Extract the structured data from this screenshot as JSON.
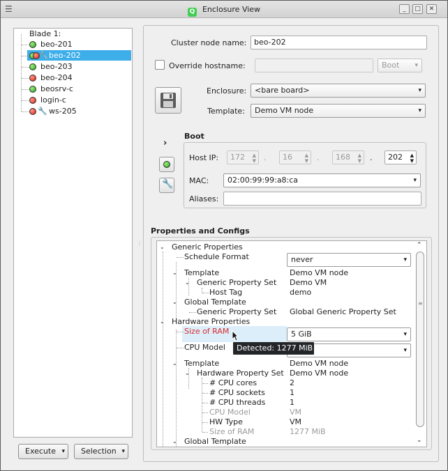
{
  "window": {
    "title": "Enclosure View",
    "menu_icon": "menu-icon",
    "minimize_icon": "minimize-icon",
    "maximize_icon": "maximize-icon",
    "close_icon": "close-icon"
  },
  "node_tree": {
    "root": "Blade 1:",
    "items": [
      {
        "label": "beo-201",
        "status": [
          "green"
        ]
      },
      {
        "label": "beo-202",
        "status": [
          "green",
          "red"
        ],
        "wrench": "red",
        "selected": true
      },
      {
        "label": "beo-203",
        "status": [
          "green"
        ]
      },
      {
        "label": "beo-204",
        "status": [
          "red"
        ]
      },
      {
        "label": "beosrv-c",
        "status": [
          "green"
        ]
      },
      {
        "label": "login-c",
        "status": [
          "red"
        ]
      },
      {
        "label": "ws-205",
        "status": [
          "red"
        ],
        "wrench": "blue"
      }
    ]
  },
  "bottom_buttons": {
    "execute": "Execute",
    "selection": "Selection",
    "arrow": "▾"
  },
  "form": {
    "cluster_node_name_label": "Cluster node name:",
    "cluster_node_name": "beo-202",
    "override_hostname_label": "Override hostname:",
    "override_hostname_value": "",
    "boot_combo": "Boot",
    "enclosure_label": "Enclosure:",
    "enclosure_value": "<bare board>",
    "template_label": "Template:",
    "template_value": "Demo VM node",
    "save_icon": "floppy-disk-icon"
  },
  "boot": {
    "section_title": "Boot",
    "host_ip_label": "Host IP:",
    "ip": [
      "172",
      "16",
      "168",
      "202"
    ],
    "ip_sep": ".",
    "mac_label": "MAC:",
    "mac_value": "02:00:99:99:a8:ca",
    "aliases_label": "Aliases:",
    "aliases_value": "",
    "expand_icon": "chevron-right-icon",
    "power_icon": "green-status-icon",
    "wrench_icon": "red-wrench-icon"
  },
  "properties": {
    "title": "Properties and Configs",
    "rows": {
      "generic_properties": "Generic Properties",
      "schedule_format": "Schedule Format",
      "schedule_format_value": "never",
      "template1": "Template",
      "template1_value": "Demo VM node",
      "gps1": "Generic Property Set",
      "gps1_value": "Demo VM",
      "host_tag": "Host Tag",
      "host_tag_value": "demo",
      "global_template1": "Global Template",
      "gps2": "Generic Property Set",
      "gps2_value": "Global Generic Property Set",
      "hardware_properties": "Hardware Properties",
      "size_of_ram": "Size of RAM",
      "size_of_ram_value": "5 GiB",
      "cpu_model": "CPU Model",
      "cpu_model_value": "",
      "template2": "Template",
      "template2_value": "Demo VM node",
      "hps": "Hardware Property Set",
      "hps_value": "Demo VM node",
      "cpu_cores": "# CPU cores",
      "cpu_cores_value": "2",
      "cpu_sockets": "# CPU sockets",
      "cpu_sockets_value": "1",
      "cpu_threads": "# CPU threads",
      "cpu_threads_value": "1",
      "cpu_model2": "CPU Model",
      "cpu_model2_value": "VM",
      "hw_type": "HW Type",
      "hw_type_value": "VM",
      "size_of_ram2": "Size of RAM",
      "size_of_ram2_value": "1277 MiB",
      "global_template2": "Global Template"
    },
    "tooltip": "Detected: 1277 MiB"
  },
  "colors": {
    "selection": "#3daee9",
    "error_label": "#d92b2b",
    "tooltip_bg": "#232629"
  }
}
